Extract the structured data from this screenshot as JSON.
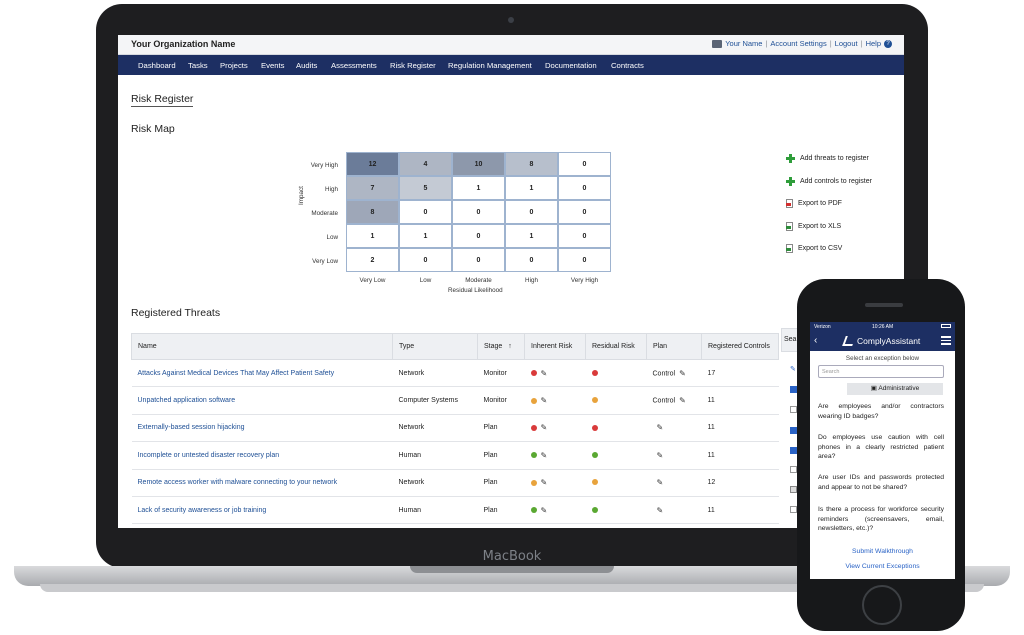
{
  "app": {
    "org_name": "Your Organization Name",
    "user_links": [
      "Your Name",
      "Account Settings",
      "Logout",
      "Help"
    ],
    "nav": [
      "Dashboard",
      "Tasks",
      "Projects",
      "Events",
      "Audits",
      "Assessments",
      "Risk Register",
      "Regulation Management",
      "Documentation",
      "Contracts"
    ]
  },
  "page": {
    "title": "Risk Register",
    "risk_map_title": "Risk Map",
    "threats_title": "Registered Threats"
  },
  "heatmap": {
    "ylabel": "Impact",
    "xlabel": "Residual Likelihood",
    "rows": [
      "Very High",
      "High",
      "Moderate",
      "Low",
      "Very Low"
    ],
    "cols": [
      "Very Low",
      "Low",
      "Moderate",
      "High",
      "Very High"
    ],
    "values": [
      [
        "12",
        "4",
        "10",
        "8",
        "0"
      ],
      [
        "7",
        "5",
        "1",
        "1",
        "0"
      ],
      [
        "8",
        "0",
        "0",
        "0",
        "0"
      ],
      [
        "1",
        "1",
        "0",
        "1",
        "0"
      ],
      [
        "2",
        "0",
        "0",
        "0",
        "0"
      ]
    ],
    "colors": [
      [
        "#6b7c99",
        "#aeb6c4",
        "#8d98ab",
        "#b7bfcc",
        "#ffffff"
      ],
      [
        "#aeb6c4",
        "#c4cad4",
        "#ffffff",
        "#ffffff",
        "#ffffff"
      ],
      [
        "#9ea7b8",
        "#ffffff",
        "#ffffff",
        "#ffffff",
        "#ffffff"
      ],
      [
        "#ffffff",
        "#ffffff",
        "#ffffff",
        "#ffffff",
        "#ffffff"
      ],
      [
        "#ffffff",
        "#ffffff",
        "#ffffff",
        "#ffffff",
        "#ffffff"
      ]
    ]
  },
  "actions": [
    "Add threats to register",
    "Add controls to register",
    "Export to PDF",
    "Export to XLS",
    "Export to CSV"
  ],
  "table": {
    "headers": [
      "Name",
      "Type",
      "Stage",
      "Inherent Risk",
      "Residual Risk",
      "Plan",
      "Registered Controls"
    ],
    "search_fragment": "Sea",
    "rows": [
      {
        "name": "Attacks Against Medical Devices That May Affect Patient Safety",
        "type": "Network",
        "stage": "Monitor",
        "inherent": "#d93a3a",
        "residual": "#d93a3a",
        "plan": "Control",
        "controls": "17"
      },
      {
        "name": "Unpatched application software",
        "type": "Computer Systems",
        "stage": "Monitor",
        "inherent": "#e8a33c",
        "residual": "#e8a33c",
        "plan": "Control",
        "controls": "11"
      },
      {
        "name": "Externally-based session hijacking",
        "type": "Network",
        "stage": "Plan",
        "inherent": "#d93a3a",
        "residual": "#d93a3a",
        "plan": "",
        "controls": "11"
      },
      {
        "name": "Incomplete or untested disaster recovery plan",
        "type": "Human",
        "stage": "Plan",
        "inherent": "#5aa832",
        "residual": "#5aa832",
        "plan": "",
        "controls": "11"
      },
      {
        "name": "Remote access worker with malware connecting to your network",
        "type": "Network",
        "stage": "Plan",
        "inherent": "#e8a33c",
        "residual": "#e8a33c",
        "plan": "",
        "controls": "12"
      },
      {
        "name": "Lack of security awareness or job training",
        "type": "Human",
        "stage": "Plan",
        "inherent": "#5aa832",
        "residual": "#5aa832",
        "plan": "",
        "controls": "11"
      }
    ]
  },
  "laptop_brand": "MacBook",
  "phone": {
    "carrier": "Verizon",
    "time": "10:26 AM",
    "app_name": "ComplyAssistant",
    "subtitle": "Select an exception below",
    "search_placeholder": "Search",
    "filter": "Administrative",
    "questions": [
      "Are employees and/or contractors wearing ID badges?",
      "Do employees use caution with cell phones in a clearly restricted patient area?",
      "Are user IDs and passwords protected and appear to not be shared?",
      "Is there a process for workforce security reminders (screensavers, email, newsletters, etc.)?"
    ],
    "links": [
      "Submit Walkthrough",
      "View Current Exceptions"
    ]
  }
}
